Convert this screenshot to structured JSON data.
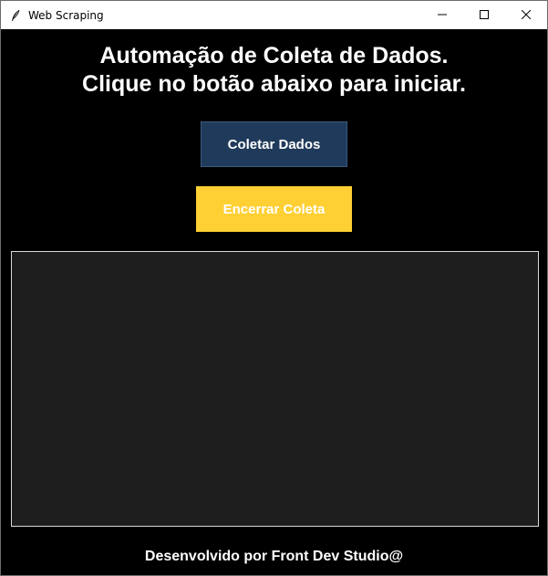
{
  "window": {
    "title": "Web Scraping",
    "app_icon": "feather-icon",
    "controls": {
      "minimize_icon": "minimize-icon",
      "maximize_icon": "maximize-icon",
      "close_icon": "close-icon"
    }
  },
  "main": {
    "heading_line1": "Automação de Coleta de Dados.",
    "heading_line2": "Clique no botão abaixo para iniciar.",
    "collect_button_label": "Coletar Dados",
    "stop_button_label": "Encerrar Coleta",
    "log_text": "",
    "footer_text": "Desenvolvido por Front Dev Studio@"
  },
  "colors": {
    "background": "#000000",
    "collect_button": "#1f3a5a",
    "stop_button": "#fed034",
    "log_background": "#1e1e1e",
    "text": "#ffffff"
  }
}
